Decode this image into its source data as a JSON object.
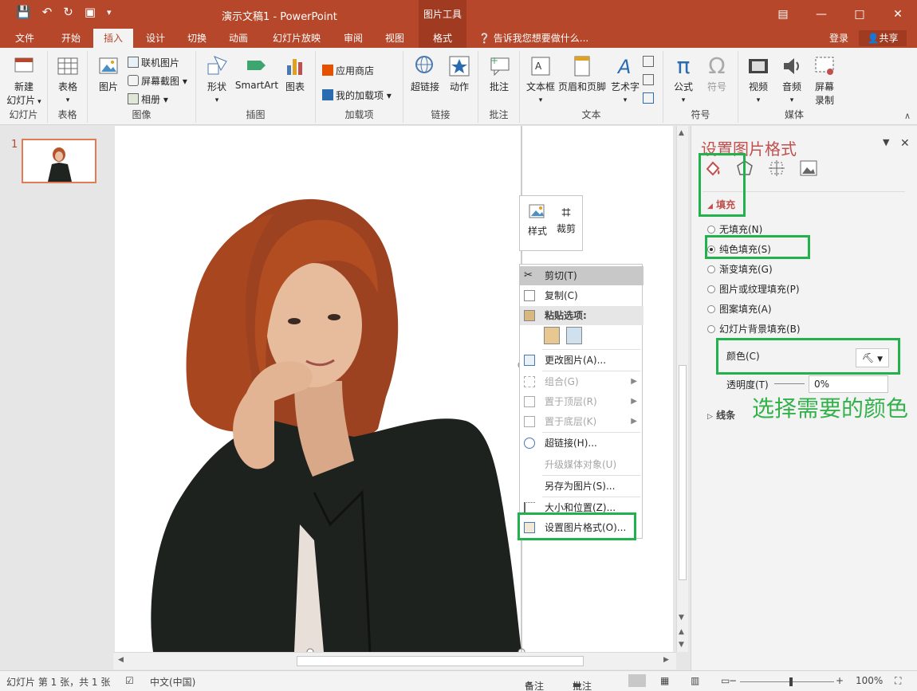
{
  "titlebar": {
    "doc_title": "演示文稿1 - PowerPoint",
    "context_tools": "图片工具"
  },
  "tabs": {
    "file": "文件",
    "home": "开始",
    "insert": "插入",
    "design": "设计",
    "transitions": "切换",
    "animations": "动画",
    "slideshow": "幻灯片放映",
    "review": "审阅",
    "view": "视图",
    "format": "格式",
    "tellme": "告诉我您想要做什么...",
    "login": "登录",
    "share": "共享"
  },
  "ribbon": {
    "new_slide": "新建",
    "new_slide2": "幻灯片",
    "table": "表格",
    "picture": "图片",
    "online_picture": "联机图片",
    "screenshot": "屏幕截图",
    "album": "相册",
    "shapes": "形状",
    "smartart": "SmartArt",
    "chart": "图表",
    "store": "应用商店",
    "my_addins": "我的加载项",
    "hyperlink": "超链接",
    "action": "动作",
    "comment": "批注",
    "textbox": "文本框",
    "header_footer": "页眉和页脚",
    "wordart": "艺术字",
    "equation": "公式",
    "symbol": "符号",
    "video": "视频",
    "audio": "音频",
    "screen_record": "屏幕",
    "screen_record2": "录制",
    "groups": {
      "slides": "幻灯片",
      "tables": "表格",
      "images": "图像",
      "illustrations": "插图",
      "addins": "加载项",
      "links": "链接",
      "comments": "批注",
      "text": "文本",
      "symbols": "符号",
      "media": "媒体"
    }
  },
  "thumbs": {
    "number": "1"
  },
  "minibar": {
    "style": "样式",
    "crop": "裁剪"
  },
  "context_menu": {
    "cut": "剪切(T)",
    "copy": "复制(C)",
    "paste_options": "粘贴选项:",
    "change_picture": "更改图片(A)...",
    "group": "组合(G)",
    "bring_front": "置于顶层(R)",
    "send_back": "置于底层(K)",
    "hyperlink": "超链接(H)...",
    "upgrade_media": "升级媒体对象(U)",
    "save_as_picture": "另存为图片(S)...",
    "size_position": "大小和位置(Z)...",
    "format_picture": "设置图片格式(O)..."
  },
  "format_pane": {
    "title": "设置图片格式",
    "fill_section": "填充",
    "options": [
      "无填充(N)",
      "纯色填充(S)",
      "渐变填充(G)",
      "图片或纹理填充(P)",
      "图案填充(A)",
      "幻灯片背景填充(B)"
    ],
    "color_label": "颜色(C)",
    "transparency_label": "透明度(T)",
    "transparency_value": "0%",
    "line_section": "线条"
  },
  "annotation": "选择需要的颜色",
  "status": {
    "slide_info": "幻灯片 第 1 张，共 1 张",
    "language": "中文(中国)",
    "notes": "备注",
    "comments": "批注",
    "zoom": "100%"
  },
  "colors": {
    "accent": "#b7472a",
    "highlight_box": "#22b14c",
    "pane_title": "#c0504d"
  }
}
